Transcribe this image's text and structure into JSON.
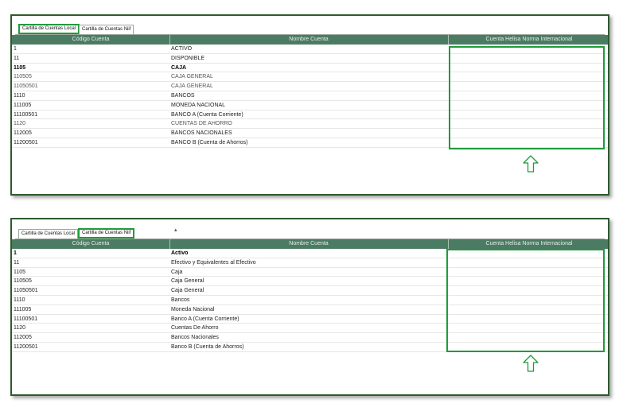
{
  "top_panel": {
    "tabs": [
      {
        "label": "Cartilla de Cuentas Local",
        "active": true
      },
      {
        "label": "Cartilla de Cuentas Niif",
        "active": false
      }
    ],
    "columns": [
      "Código Cuenta",
      "Nombre Cuenta",
      "Cuenta Helisa Norma Internacional"
    ],
    "rows": [
      {
        "code": "1",
        "name": "ACTIVO",
        "bold": false
      },
      {
        "code": "11",
        "name": "DISPONIBLE",
        "bold": false
      },
      {
        "code": "1105",
        "name": "CAJA",
        "bold": true
      },
      {
        "code": "110505",
        "name": "CAJA GENERAL",
        "bold": false
      },
      {
        "code": "11050501",
        "name": "CAJA GENERAL",
        "bold": false
      },
      {
        "code": "1110",
        "name": "BANCOS",
        "bold": false
      },
      {
        "code": "111005",
        "name": "MONEDA NACIONAL",
        "bold": false
      },
      {
        "code": "11100501",
        "name": "BANCO A (Cuenta Corriente)",
        "bold": false
      },
      {
        "code": "1120",
        "name": "CUENTAS DE AHORRO",
        "bold": false
      },
      {
        "code": "112005",
        "name": "BANCOS NACIONALES",
        "bold": false
      },
      {
        "code": "11200501",
        "name": "BANCO B (Cuenta de Ahorros)",
        "bold": false
      }
    ]
  },
  "bottom_panel": {
    "tabs": [
      {
        "label": "Cartilla de Cuentas Local",
        "active": false
      },
      {
        "label": "Cartilla de Cuentas Niif",
        "active": true
      }
    ],
    "caret": "▴",
    "columns": [
      "Código Cuenta",
      "Nombre Cuenta",
      "Cuenta Helisa Norma Internacional"
    ],
    "rows": [
      {
        "code": "1",
        "name": "Activo",
        "bold": true
      },
      {
        "code": "11",
        "name": "Efectivo y Equivalentes al Efectivo",
        "bold": false
      },
      {
        "code": "1105",
        "name": "Caja",
        "bold": false
      },
      {
        "code": "110505",
        "name": "Caja General",
        "bold": false
      },
      {
        "code": "11050501",
        "name": "Caja General",
        "bold": false
      },
      {
        "code": "1110",
        "name": "Bancos",
        "bold": false
      },
      {
        "code": "111005",
        "name": "Moneda Nacional",
        "bold": false
      },
      {
        "code": "11100501",
        "name": "Banco A (Cuenta Corriente)",
        "bold": false
      },
      {
        "code": "1120",
        "name": "Cuentas De Ahorro",
        "bold": false
      },
      {
        "code": "112005",
        "name": "Bancos Nacionales",
        "bold": false
      },
      {
        "code": "11200501",
        "name": "Banco B (Cuenta de Ahorros)",
        "bold": false
      }
    ]
  },
  "colors": {
    "header_bg": "#4c7b63",
    "highlight": "#1f9b3a",
    "frame": "#2e5a2e"
  },
  "icons": {
    "arrow": "arrow-up-outline-icon"
  }
}
